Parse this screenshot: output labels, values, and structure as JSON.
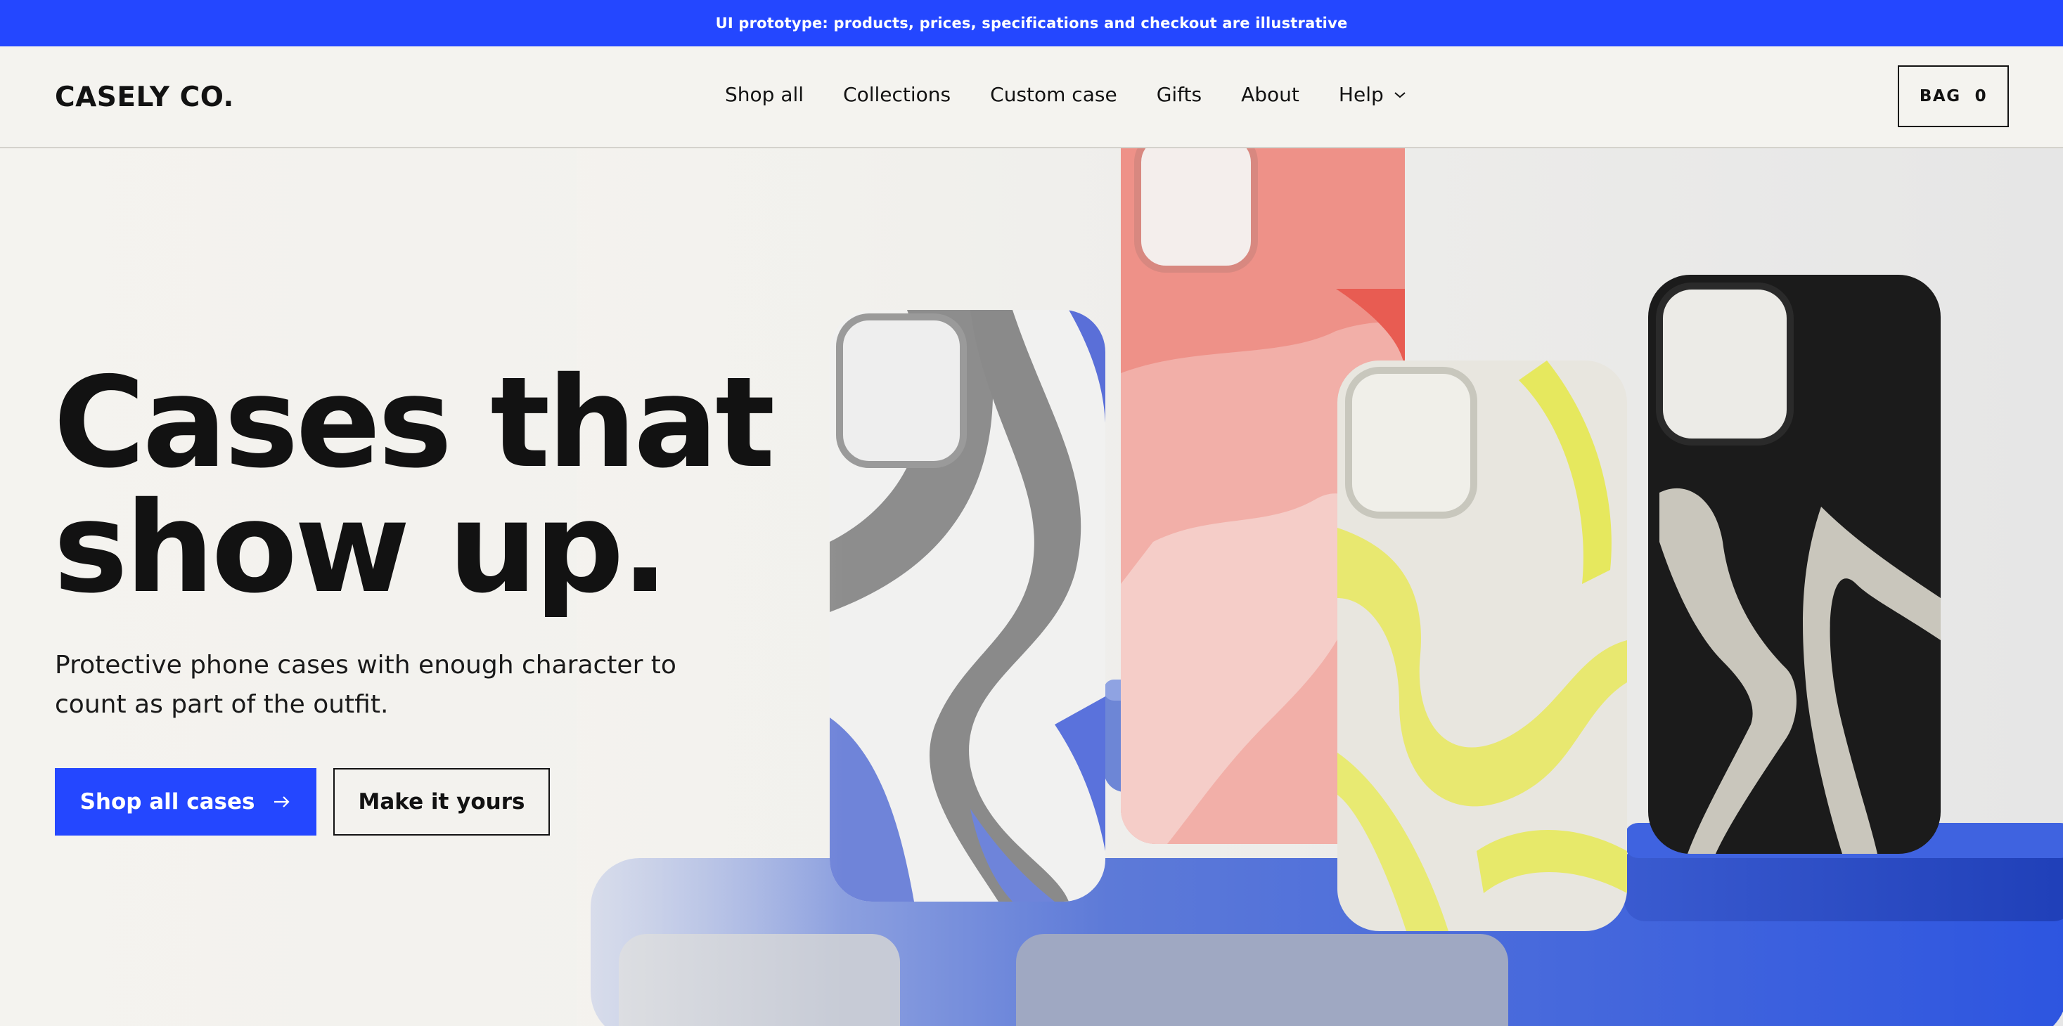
{
  "promo": {
    "text": "UI prototype: products, prices, specifications and checkout are illustrative"
  },
  "header": {
    "logo": "CASELY CO.",
    "nav": [
      {
        "label": "Shop all"
      },
      {
        "label": "Collections"
      },
      {
        "label": "Custom case"
      },
      {
        "label": "Gifts"
      },
      {
        "label": "About"
      },
      {
        "label": "Help",
        "icon": "chevron-down-icon"
      }
    ],
    "bag": {
      "label": "BAG",
      "count": "0"
    }
  },
  "hero": {
    "headline_line1": "Cases that",
    "headline_line2": "show up.",
    "subtitle": "Protective phone cases with enough character to count as part of the outfit.",
    "primary_cta": "Shop all cases",
    "primary_cta_icon": "arrow-right-icon",
    "secondary_cta": "Make it yours"
  },
  "colors": {
    "accent": "#2447ff",
    "background": "#f4f3ef",
    "text": "#121212"
  }
}
